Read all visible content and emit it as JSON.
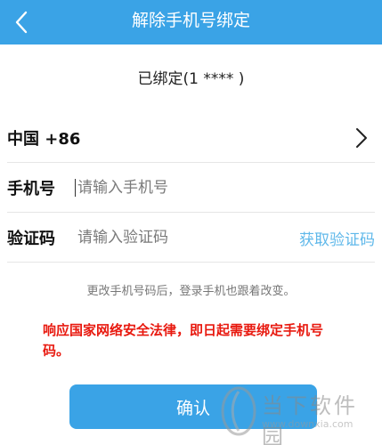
{
  "theme": {
    "accent": "#3aa3e6",
    "warn": "#e8190f"
  },
  "header": {
    "title": "解除手机号绑定",
    "back_icon": "chevron-left-icon"
  },
  "bound_text": "已绑定(1  ****   )",
  "country": {
    "label": "中国 +86",
    "arrow_icon": "chevron-right-icon"
  },
  "phone": {
    "label": "手机号",
    "placeholder": "请输入手机号"
  },
  "code": {
    "label": "验证码",
    "placeholder": "请输入验证码",
    "get_code": "获取验证码"
  },
  "hint": "更改手机号码后，登录手机也跟着改变。",
  "warning": "响应国家网络安全法律，即日起需要绑定手机号码。",
  "confirm_label": "确认",
  "watermark": {
    "text": "当下软件园",
    "url": "www.downxia.com"
  }
}
